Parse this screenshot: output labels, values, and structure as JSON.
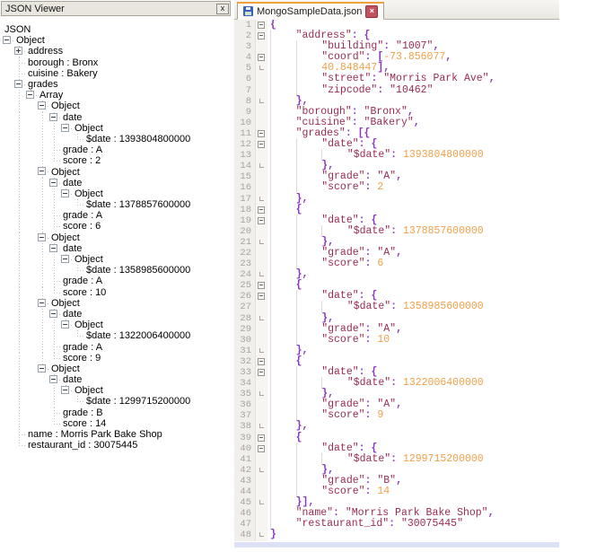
{
  "left_panel": {
    "title": "JSON Viewer",
    "close_glyph": "x",
    "tree": [
      {
        "l": 0,
        "icon": "none",
        "t": "JSON",
        "root": true
      },
      {
        "l": 0,
        "icon": "minus",
        "t": "Object",
        "nostub": true
      },
      {
        "l": 1,
        "icon": "plus",
        "t": "address"
      },
      {
        "l": 1,
        "icon": "leaf",
        "t": "borough : Bronx"
      },
      {
        "l": 1,
        "icon": "leaf",
        "t": "cuisine : Bakery"
      },
      {
        "l": 1,
        "icon": "minus",
        "t": "grades"
      },
      {
        "l": 2,
        "icon": "minus",
        "t": "Array"
      },
      {
        "l": 3,
        "icon": "minus",
        "t": "Object"
      },
      {
        "l": 4,
        "icon": "minus",
        "t": "date"
      },
      {
        "l": 5,
        "icon": "minus",
        "t": "Object"
      },
      {
        "l": 6,
        "icon": "leaf",
        "t": "$date : 1393804800000"
      },
      {
        "l": 4,
        "icon": "leaf",
        "t": "grade : A"
      },
      {
        "l": 4,
        "icon": "leaf",
        "t": "score : 2"
      },
      {
        "l": 3,
        "icon": "minus",
        "t": "Object"
      },
      {
        "l": 4,
        "icon": "minus",
        "t": "date"
      },
      {
        "l": 5,
        "icon": "minus",
        "t": "Object"
      },
      {
        "l": 6,
        "icon": "leaf",
        "t": "$date : 1378857600000"
      },
      {
        "l": 4,
        "icon": "leaf",
        "t": "grade : A"
      },
      {
        "l": 4,
        "icon": "leaf",
        "t": "score : 6"
      },
      {
        "l": 3,
        "icon": "minus",
        "t": "Object"
      },
      {
        "l": 4,
        "icon": "minus",
        "t": "date"
      },
      {
        "l": 5,
        "icon": "minus",
        "t": "Object"
      },
      {
        "l": 6,
        "icon": "leaf",
        "t": "$date : 1358985600000"
      },
      {
        "l": 4,
        "icon": "leaf",
        "t": "grade : A"
      },
      {
        "l": 4,
        "icon": "leaf",
        "t": "score : 10"
      },
      {
        "l": 3,
        "icon": "minus",
        "t": "Object"
      },
      {
        "l": 4,
        "icon": "minus",
        "t": "date"
      },
      {
        "l": 5,
        "icon": "minus",
        "t": "Object"
      },
      {
        "l": 6,
        "icon": "leaf",
        "t": "$date : 1322006400000"
      },
      {
        "l": 4,
        "icon": "leaf",
        "t": "grade : A"
      },
      {
        "l": 4,
        "icon": "leaf",
        "t": "score : 9"
      },
      {
        "l": 3,
        "icon": "minus",
        "t": "Object"
      },
      {
        "l": 4,
        "icon": "minus",
        "t": "date"
      },
      {
        "l": 5,
        "icon": "minus",
        "t": "Object"
      },
      {
        "l": 6,
        "icon": "leaf",
        "t": "$date : 1299715200000"
      },
      {
        "l": 4,
        "icon": "leaf",
        "t": "grade : B"
      },
      {
        "l": 4,
        "icon": "leaf",
        "t": "score : 14"
      },
      {
        "l": 1,
        "icon": "leaf",
        "t": "name : Morris Park Bake Shop"
      },
      {
        "l": 1,
        "icon": "leaf",
        "t": "restaurant_id : 30075445"
      }
    ]
  },
  "editor": {
    "tab_label": "MongoSampleData.json",
    "tab_close_glyph": "×",
    "lines": [
      {
        "n": 1,
        "f": "s",
        "t": "{"
      },
      {
        "n": 2,
        "f": "s",
        "t": "    \"address\": {"
      },
      {
        "n": 3,
        "f": "",
        "t": "        \"building\": \"1007\","
      },
      {
        "n": 4,
        "f": "s",
        "t": "        \"coord\": [-73.856077,"
      },
      {
        "n": 5,
        "f": "e",
        "t": "        40.848447],"
      },
      {
        "n": 6,
        "f": "",
        "t": "        \"street\": \"Morris Park Ave\","
      },
      {
        "n": 7,
        "f": "",
        "t": "        \"zipcode\": \"10462\""
      },
      {
        "n": 8,
        "f": "e",
        "t": "    },"
      },
      {
        "n": 9,
        "f": "",
        "t": "    \"borough\": \"Bronx\","
      },
      {
        "n": 10,
        "f": "",
        "t": "    \"cuisine\": \"Bakery\","
      },
      {
        "n": 11,
        "f": "s",
        "t": "    \"grades\": [{"
      },
      {
        "n": 12,
        "f": "s",
        "t": "        \"date\": {"
      },
      {
        "n": 13,
        "f": "",
        "t": "            \"$date\": 1393804800000"
      },
      {
        "n": 14,
        "f": "e",
        "t": "        },"
      },
      {
        "n": 15,
        "f": "",
        "t": "        \"grade\": \"A\","
      },
      {
        "n": 16,
        "f": "",
        "t": "        \"score\": 2"
      },
      {
        "n": 17,
        "f": "e",
        "t": "    },"
      },
      {
        "n": 18,
        "f": "s",
        "t": "    {"
      },
      {
        "n": 19,
        "f": "s",
        "t": "        \"date\": {"
      },
      {
        "n": 20,
        "f": "",
        "t": "            \"$date\": 1378857600000"
      },
      {
        "n": 21,
        "f": "e",
        "t": "        },"
      },
      {
        "n": 22,
        "f": "",
        "t": "        \"grade\": \"A\","
      },
      {
        "n": 23,
        "f": "",
        "t": "        \"score\": 6"
      },
      {
        "n": 24,
        "f": "e",
        "t": "    },"
      },
      {
        "n": 25,
        "f": "s",
        "t": "    {"
      },
      {
        "n": 26,
        "f": "s",
        "t": "        \"date\": {"
      },
      {
        "n": 27,
        "f": "",
        "t": "            \"$date\": 1358985600000"
      },
      {
        "n": 28,
        "f": "e",
        "t": "        },"
      },
      {
        "n": 29,
        "f": "",
        "t": "        \"grade\": \"A\","
      },
      {
        "n": 30,
        "f": "",
        "t": "        \"score\": 10"
      },
      {
        "n": 31,
        "f": "e",
        "t": "    },"
      },
      {
        "n": 32,
        "f": "s",
        "t": "    {"
      },
      {
        "n": 33,
        "f": "s",
        "t": "        \"date\": {"
      },
      {
        "n": 34,
        "f": "",
        "t": "            \"$date\": 1322006400000"
      },
      {
        "n": 35,
        "f": "e",
        "t": "        },"
      },
      {
        "n": 36,
        "f": "",
        "t": "        \"grade\": \"A\","
      },
      {
        "n": 37,
        "f": "",
        "t": "        \"score\": 9"
      },
      {
        "n": 38,
        "f": "e",
        "t": "    },"
      },
      {
        "n": 39,
        "f": "s",
        "t": "    {"
      },
      {
        "n": 40,
        "f": "s",
        "t": "        \"date\": {"
      },
      {
        "n": 41,
        "f": "",
        "t": "            \"$date\": 1299715200000"
      },
      {
        "n": 42,
        "f": "e",
        "t": "        },"
      },
      {
        "n": 43,
        "f": "",
        "t": "        \"grade\": \"B\","
      },
      {
        "n": 44,
        "f": "",
        "t": "        \"score\": 14"
      },
      {
        "n": 45,
        "f": "e",
        "t": "    }],"
      },
      {
        "n": 46,
        "f": "",
        "t": "    \"name\": \"Morris Park Bake Shop\","
      },
      {
        "n": 47,
        "f": "",
        "t": "    \"restaurant_id\": \"30075445\""
      },
      {
        "n": 48,
        "f": "e",
        "t": "}"
      }
    ]
  },
  "colors": {
    "string": "#9A2A52",
    "number": "#F0A04B",
    "punct": "#8B35C0",
    "tab_accent": "#F0A23C",
    "linenum": "#A8A49D",
    "titlebar": "#E9E6E0",
    "scrollbar": "#DDE1F6"
  }
}
